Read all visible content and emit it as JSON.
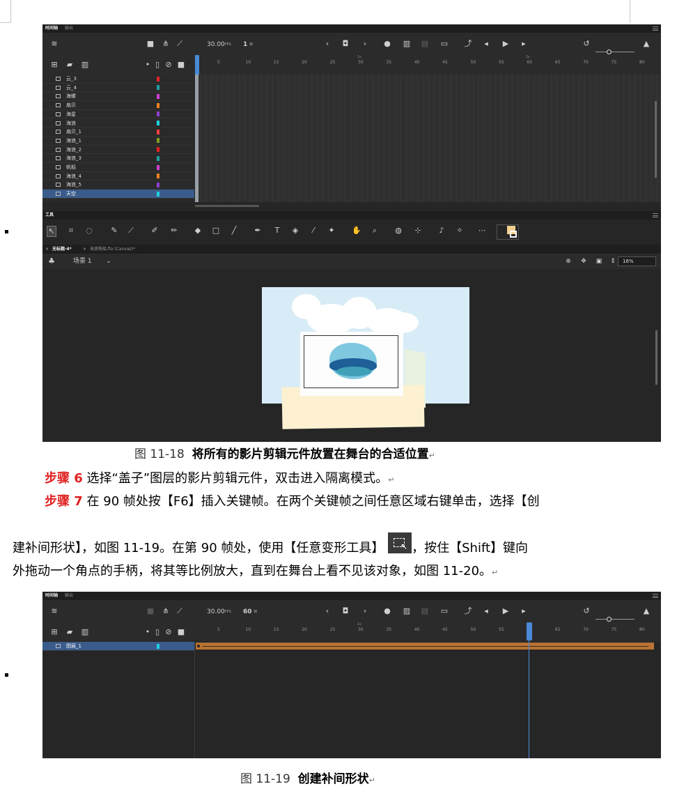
{
  "screenshot1": {
    "timeline_tabs": [
      "时间轴",
      "输出"
    ],
    "fps": "30.00",
    "fps_unit": "FPS",
    "current_frame": "1",
    "frame_unit": "帧",
    "seconds_marks": [
      "1s",
      "2s"
    ],
    "ruler_numbers": [
      "5",
      "10",
      "15",
      "20",
      "25",
      "30",
      "35",
      "40",
      "45",
      "50",
      "55",
      "60",
      "65",
      "70",
      "75",
      "80"
    ],
    "layers": [
      {
        "name": "云_3",
        "color": "#e0262c"
      },
      {
        "name": "云_4",
        "color": "#20a0a0"
      },
      {
        "name": "海螺",
        "color": "#d040d0"
      },
      {
        "name": "扇贝",
        "color": "#f08020"
      },
      {
        "name": "海星",
        "color": "#9040d0"
      },
      {
        "name": "海浪",
        "color": "#20d0e0"
      },
      {
        "name": "扇贝_1",
        "color": "#f04040"
      },
      {
        "name": "海浪_1",
        "color": "#80a020"
      },
      {
        "name": "海浪_2",
        "color": "#e02020"
      },
      {
        "name": "海浪_3",
        "color": "#20a0a0"
      },
      {
        "name": "帆船",
        "color": "#d040d0"
      },
      {
        "name": "海浪_4",
        "color": "#f08020"
      },
      {
        "name": "海浪_5",
        "color": "#9040d0"
      },
      {
        "name": "天空",
        "color": "#20d0e0"
      }
    ],
    "tools_title": "工具",
    "doc_tabs": [
      "无标题-4*",
      "海浪帆船.fla (Canvas)*"
    ],
    "scene_label": "场景 1",
    "zoom": "16%"
  },
  "caption1": {
    "num": "图 11-18",
    "text": "将所有的影片剪辑元件放置在舞台的合适位置"
  },
  "para1": {
    "step": "步骤 6",
    "text": "选择“盖子”图层的影片剪辑元件，双击进入隔离模式。"
  },
  "para2": {
    "step": "步骤 7",
    "text": "在 90 帧处按【F6】插入关键帧。在两个关键帧之间任意区域右键单击，选择【创"
  },
  "para3": {
    "text_a": "建补间形状】，如图 11-19。在第 90 帧处，使用【任意变形工具】",
    "text_b": "，按住【Shift】键向"
  },
  "para4": {
    "text": "外拖动一个角点的手柄，将其等比例放大，直到在舞台上看不见该对象，如图 11-20。"
  },
  "screenshot2": {
    "timeline_tabs": [
      "时间轴",
      "输出"
    ],
    "fps": "30.00",
    "fps_unit": "FPS",
    "current_frame": "60",
    "frame_unit": "帧",
    "seconds_marks": [
      "1s"
    ],
    "layer_name": "图层_1",
    "layer_color": "#20d0e0"
  },
  "caption2": {
    "num": "图 11-19",
    "text": "创建补间形状"
  },
  "colors": {
    "step_red": "#e02020",
    "selected_layer": "#3a5c8c",
    "tween": "#b87333",
    "playhead": "#4a8ad8"
  }
}
